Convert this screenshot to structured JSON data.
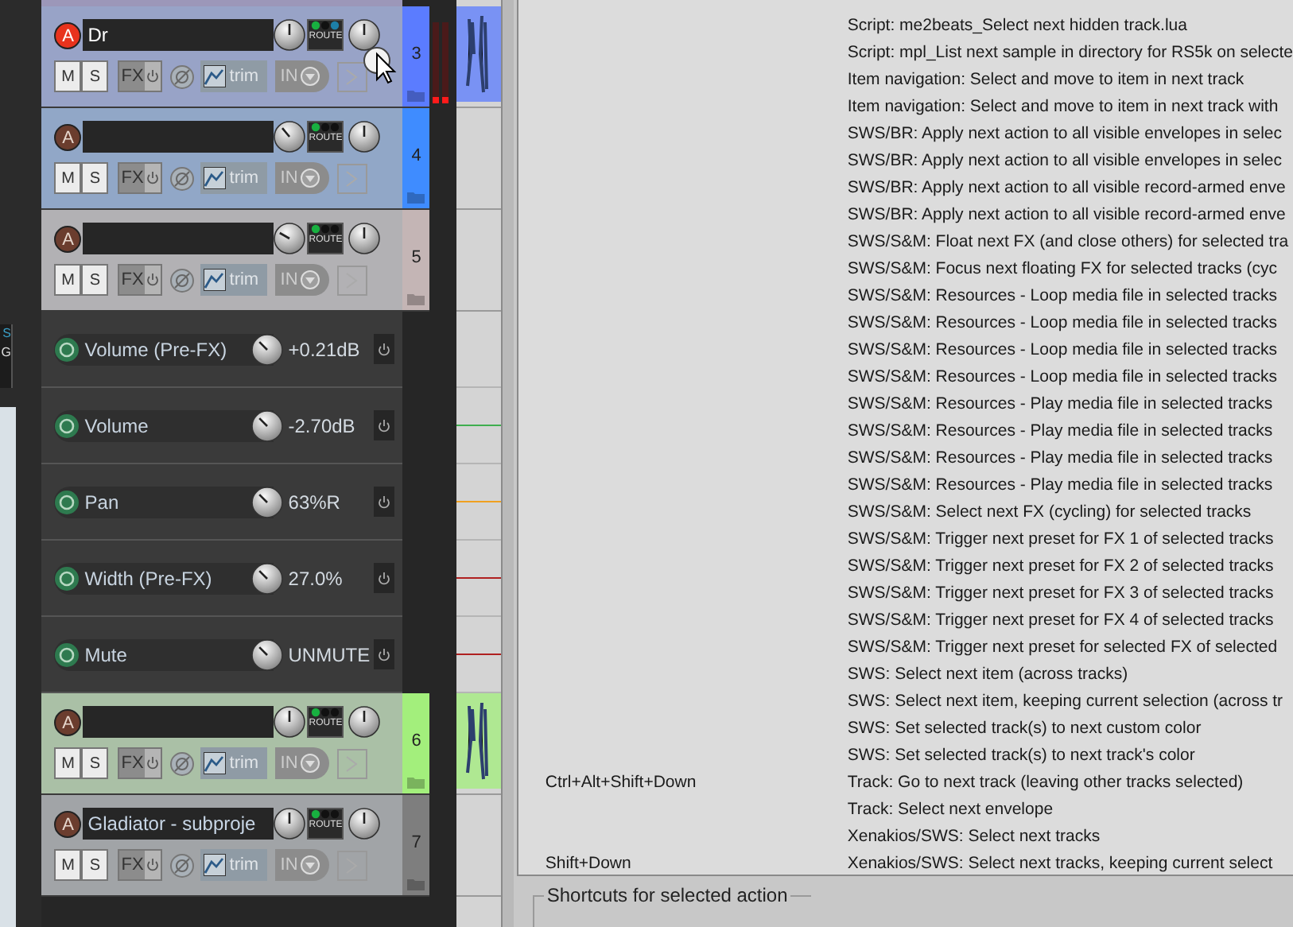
{
  "left_panel": {
    "labels": [
      "S",
      "G"
    ]
  },
  "tracks": [
    {
      "number": "3",
      "name": "Dr",
      "armed": true,
      "color": "#5b7cff",
      "media_item": true,
      "controls": {
        "arm": "A",
        "route": "ROUTE",
        "mute": "M",
        "solo": "S",
        "fx": "FX",
        "trim": "trim",
        "input": "IN"
      }
    },
    {
      "number": "4",
      "armed": false,
      "color": "#3f8cff",
      "media_item": false,
      "controls": {
        "arm": "A",
        "route": "ROUTE",
        "mute": "M",
        "solo": "S",
        "fx": "FX",
        "trim": "trim",
        "input": "IN"
      }
    },
    {
      "number": "5",
      "armed": false,
      "color": "#c4b5b5",
      "media_item": false,
      "controls": {
        "arm": "A",
        "route": "ROUTE",
        "mute": "M",
        "solo": "S",
        "fx": "FX",
        "trim": "trim",
        "input": "IN"
      },
      "envelopes": [
        {
          "label": "Volume (Pre-FX)",
          "value": "+0.21dB"
        },
        {
          "label": "Volume",
          "value": "-2.70dB",
          "color": "#3fae4f"
        },
        {
          "label": "Pan",
          "value": "63%R",
          "color": "#f0a020"
        },
        {
          "label": "Width (Pre-FX)",
          "value": "27.0%",
          "color": "#b02020"
        },
        {
          "label": "Mute",
          "value": "UNMUTE",
          "color": "#b02020"
        }
      ]
    },
    {
      "number": "6",
      "armed": false,
      "color": "#a3ef7c",
      "media_item": true,
      "controls": {
        "arm": "A",
        "route": "ROUTE",
        "mute": "M",
        "solo": "S",
        "fx": "FX",
        "trim": "trim",
        "input": "IN"
      }
    },
    {
      "number": "7",
      "name": "Gladiator - subproje",
      "armed": false,
      "color": "#7e7e7e",
      "media_item": false,
      "controls": {
        "arm": "A",
        "route": "ROUTE",
        "mute": "M",
        "solo": "S",
        "fx": "FX",
        "trim": "trim",
        "input": "IN"
      }
    }
  ],
  "actions": [
    {
      "description": "Script: me2beats_Select next hidden track.lua"
    },
    {
      "description": "Script: mpl_List next sample in directory for RS5k on selecte"
    },
    {
      "description": "Item navigation: Select and move to item in next track"
    },
    {
      "description": "Item navigation: Select and move to item in next track with"
    },
    {
      "description": "SWS/BR: Apply next action to all visible envelopes in selec"
    },
    {
      "description": "SWS/BR: Apply next action to all visible envelopes in selec"
    },
    {
      "description": "SWS/BR: Apply next action to all visible record-armed enve"
    },
    {
      "description": "SWS/BR: Apply next action to all visible record-armed enve"
    },
    {
      "description": "SWS/S&M: Float next FX (and close others) for selected tra"
    },
    {
      "description": "SWS/S&M: Focus next floating FX for selected tracks (cyc"
    },
    {
      "description": "SWS/S&M: Resources - Loop media file in selected tracks"
    },
    {
      "description": "SWS/S&M: Resources - Loop media file in selected tracks"
    },
    {
      "description": "SWS/S&M: Resources - Loop media file in selected tracks"
    },
    {
      "description": "SWS/S&M: Resources - Loop media file in selected tracks"
    },
    {
      "description": "SWS/S&M: Resources - Play media file in selected tracks"
    },
    {
      "description": "SWS/S&M: Resources - Play media file in selected tracks"
    },
    {
      "description": "SWS/S&M: Resources - Play media file in selected tracks"
    },
    {
      "description": "SWS/S&M: Resources - Play media file in selected tracks"
    },
    {
      "description": "SWS/S&M: Select next FX (cycling) for selected tracks"
    },
    {
      "description": "SWS/S&M: Trigger next preset for FX 1 of selected tracks"
    },
    {
      "description": "SWS/S&M: Trigger next preset for FX 2 of selected tracks"
    },
    {
      "description": "SWS/S&M: Trigger next preset for FX 3 of selected tracks"
    },
    {
      "description": "SWS/S&M: Trigger next preset for FX 4 of selected tracks"
    },
    {
      "description": "SWS/S&M: Trigger next preset for selected FX of selected"
    },
    {
      "description": "SWS: Select next item (across tracks)"
    },
    {
      "description": "SWS: Select next item, keeping current selection (across tr"
    },
    {
      "description": "SWS: Set selected track(s) to next custom color"
    },
    {
      "description": "SWS: Set selected track(s) to next track's color"
    },
    {
      "shortcut": "Ctrl+Alt+Shift+Down",
      "description": "Track: Go to next track (leaving other tracks selected)"
    },
    {
      "description": "Track: Select next envelope"
    },
    {
      "description": "Xenakios/SWS: Select next tracks"
    },
    {
      "shortcut": "Shift+Down",
      "description": "Xenakios/SWS: Select next tracks, keeping current select"
    }
  ],
  "shortcuts_group": {
    "title": "Shortcuts for selected action"
  }
}
